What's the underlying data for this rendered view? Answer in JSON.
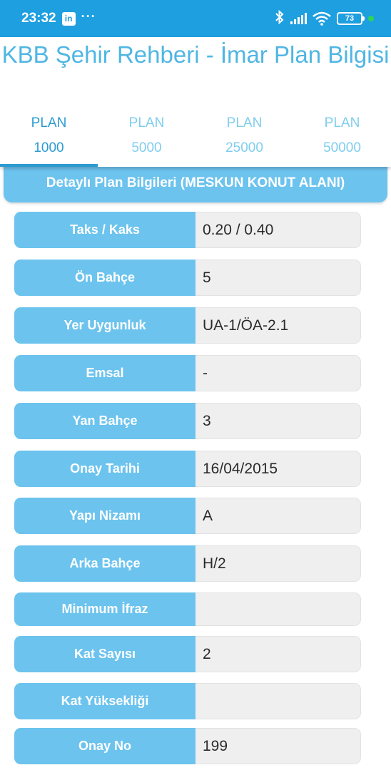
{
  "status_bar": {
    "time": "23:32",
    "app_icon": "linkedin-icon",
    "battery": "73"
  },
  "app": {
    "title": "KBB Şehir Rehberi - İmar Plan Bilgisi"
  },
  "tabs": [
    {
      "line1": "PLAN",
      "line2": "1000",
      "active": true
    },
    {
      "line1": "PLAN",
      "line2": "5000",
      "active": false
    },
    {
      "line1": "PLAN",
      "line2": "25000",
      "active": false
    },
    {
      "line1": "PLAN",
      "line2": "50000",
      "active": false
    }
  ],
  "section": {
    "title": "Detaylı Plan Bilgileri (MESKUN KONUT ALANI)"
  },
  "rows": [
    {
      "label": "Taks / Kaks",
      "value": "0.20 / 0.40"
    },
    {
      "label": "Ön Bahçe",
      "value": "5"
    },
    {
      "label": "Yer Uygunluk",
      "value": "UA-1/ÖA-2.1"
    },
    {
      "label": "Emsal",
      "value": "-"
    },
    {
      "label": "Yan Bahçe",
      "value": "3"
    },
    {
      "label": "Onay Tarihi",
      "value": "16/04/2015"
    },
    {
      "label": "Yapı Nizamı",
      "value": "A"
    },
    {
      "label": "Arka Bahçe",
      "value": "H/2"
    },
    {
      "label": "Minimum İfraz",
      "value": ""
    },
    {
      "label": "Kat Sayısı",
      "value": "2"
    },
    {
      "label": "Kat Yüksekliği",
      "value": ""
    },
    {
      "label": "Onay No",
      "value": "199"
    }
  ],
  "colors": {
    "status_bar": "#1e9fe0",
    "accent": "#6cc3ee",
    "title": "#4fb6e4",
    "active_tab": "#2c9bd1"
  }
}
